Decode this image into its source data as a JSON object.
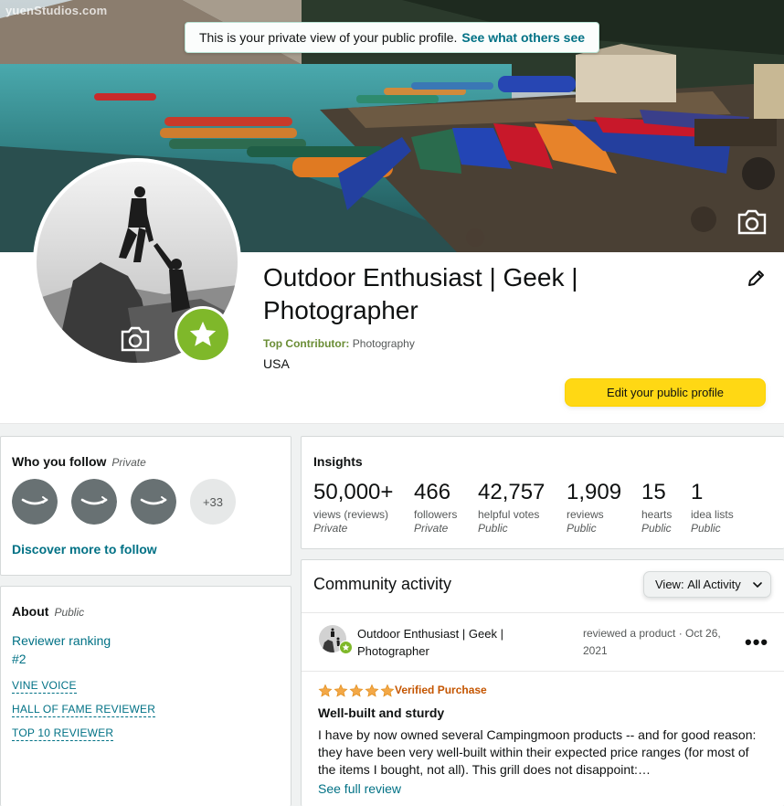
{
  "banner": {
    "watermark": "yuenStudios.com",
    "notice_text": "This is your private view of your public profile.",
    "notice_link": "See what others see",
    "camera_icon": "camera-icon"
  },
  "profile": {
    "name": "Outdoor Enthusiast | Geek | Photographer",
    "contributor_label": "Top Contributor:",
    "contributor_category": "Photography",
    "country": "USA",
    "edit_button": "Edit your public profile",
    "badge_color": "#7fb82a"
  },
  "follow": {
    "title": "Who you follow",
    "privacy": "Private",
    "more_count": "+33",
    "discover_link": "Discover more to follow"
  },
  "about": {
    "title": "About",
    "privacy": "Public",
    "ranking_label": "Reviewer ranking",
    "ranking_value": "#2",
    "badges": [
      "VINE VOICE",
      "HALL OF FAME REVIEWER",
      "TOP 10 REVIEWER"
    ]
  },
  "insights": {
    "title": "Insights",
    "stats": [
      {
        "value": "50,000+",
        "label": "views (reviews)",
        "privacy": "Private"
      },
      {
        "value": "466",
        "label": "followers",
        "privacy": "Private"
      },
      {
        "value": "42,757",
        "label": "helpful votes",
        "privacy": "Public"
      },
      {
        "value": "1,909",
        "label": "reviews",
        "privacy": "Public"
      },
      {
        "value": "15",
        "label": "hearts",
        "privacy": "Public"
      },
      {
        "value": "1",
        "label": "idea lists",
        "privacy": "Public"
      }
    ]
  },
  "activity": {
    "title": "Community activity",
    "view_label": "View:",
    "view_value": "All Activity",
    "author": "Outdoor Enthusiast | Geek | Photographer",
    "meta": "reviewed a product · Oct 26, 2021",
    "rating": 5,
    "verified": "Verified Purchase",
    "review_title": "Well-built and sturdy",
    "review_body": "I have by now owned several Campingmoon products -- and for good reason: they have been very well-built within their expected price ranges (for most of the items I bought, not all). This grill does not disappoint:…",
    "see_full": "See full review"
  },
  "colors": {
    "accent_link": "#007185",
    "button_yellow": "#ffd814",
    "star_orange": "#f3a847",
    "verified_orange": "#c45500"
  }
}
